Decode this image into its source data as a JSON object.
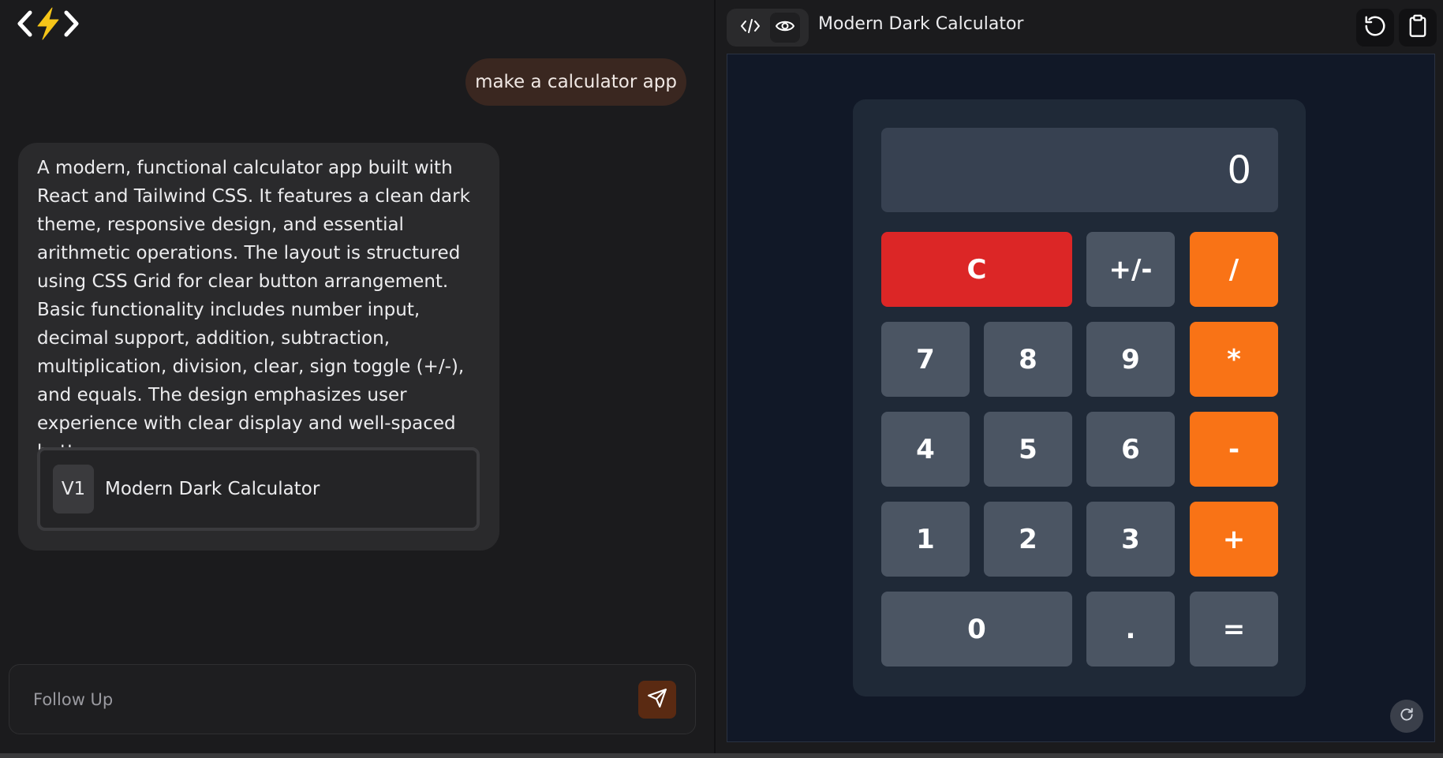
{
  "chat": {
    "user_message": "make a calculator app",
    "assistant_message": "A modern, functional calculator app built with React and Tailwind CSS. It features a clean dark theme, responsive design, and essential arithmetic operations. The layout is structured using CSS Grid for clear button arrangement. Basic functionality includes number input, decimal support, addition, subtraction, multiplication, division, clear, sign toggle (+/-), and equals. The design emphasizes user experience with clear display and well-spaced buttons.",
    "version_badge": "V1",
    "version_title": "Modern Dark Calculator"
  },
  "followup": {
    "placeholder": "Follow Up",
    "value": ""
  },
  "preview": {
    "title": "Modern Dark Calculator",
    "icons": {
      "code": "code-icon",
      "preview": "eye-icon",
      "reset": "rotate-ccw-icon",
      "copy": "clipboard-icon",
      "refresh": "refresh-icon",
      "send": "send-icon",
      "logo": "bolt-code-logo"
    }
  },
  "calculator": {
    "display": "0",
    "keys": {
      "clear": "C",
      "sign": "+/-",
      "divide": "/",
      "seven": "7",
      "eight": "8",
      "nine": "9",
      "multiply": "*",
      "four": "4",
      "five": "5",
      "six": "6",
      "subtract": "-",
      "one": "1",
      "two": "2",
      "three": "3",
      "add": "+",
      "zero": "0",
      "decimal": ".",
      "equals": "="
    }
  },
  "colors": {
    "clear_key": "#dc2626",
    "operator_key": "#f97316",
    "number_key": "#4b5563",
    "calc_body": "#1f2937",
    "display_bg": "#374151",
    "preview_bg": "#111827",
    "user_bubble": "#3a2720",
    "send_button": "#5a2a12"
  }
}
